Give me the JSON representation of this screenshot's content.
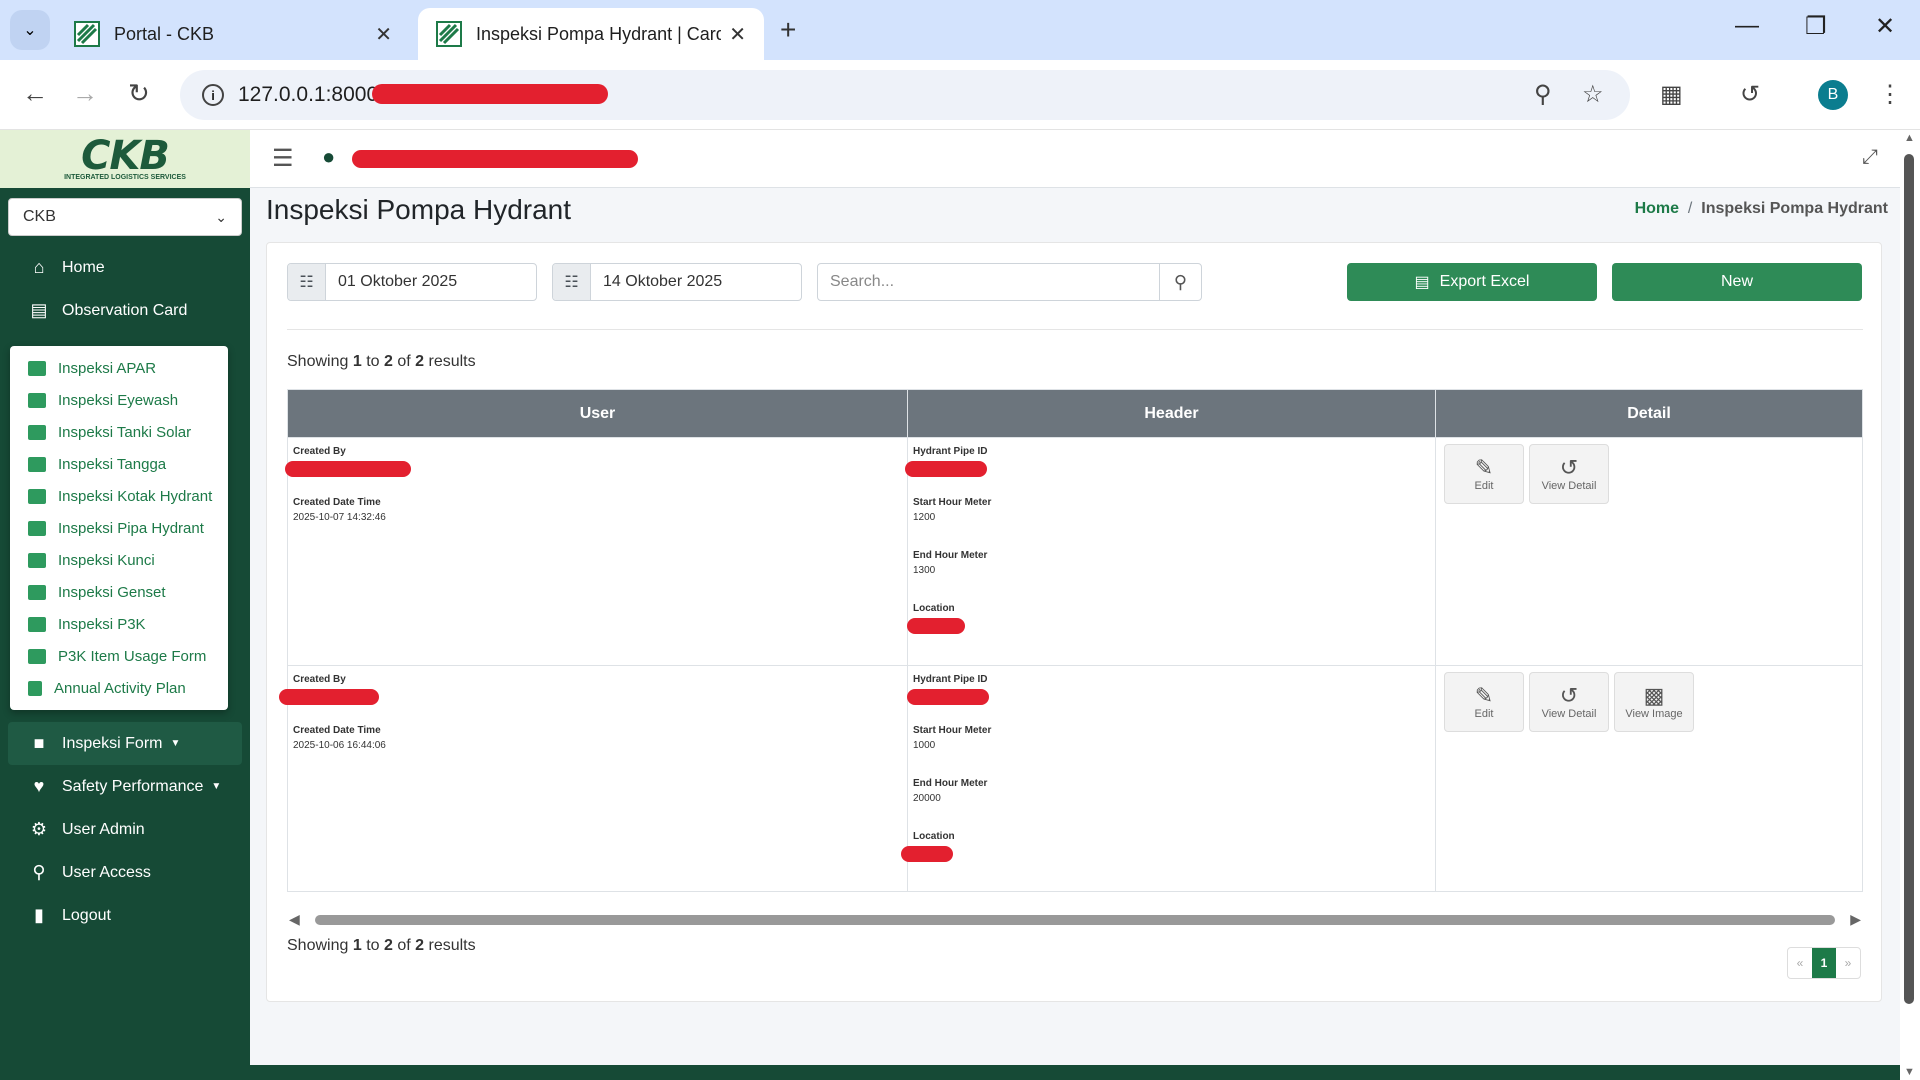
{
  "browser": {
    "tabs": [
      {
        "title": "Portal - CKB"
      },
      {
        "title": "Inspeksi Pompa Hydrant | Card"
      }
    ],
    "url": "127.0.0.1:8000/",
    "profile_initial": "B"
  },
  "sidebar": {
    "logo": "CKB",
    "logo_sub": "INTEGRATED LOGISTICS SERVICES",
    "company": "CKB",
    "items_top": [
      {
        "label": "Home",
        "icon": "home-icon"
      },
      {
        "label": "Observation Card",
        "icon": "clipboard-icon"
      }
    ],
    "dropdown": [
      {
        "label": "Inspeksi APAR"
      },
      {
        "label": "Inspeksi Eyewash"
      },
      {
        "label": "Inspeksi Tanki Solar"
      },
      {
        "label": "Inspeksi Tangga"
      },
      {
        "label": "Inspeksi Kotak Hydrant"
      },
      {
        "label": "Inspeksi Pipa Hydrant"
      },
      {
        "label": "Inspeksi Kunci"
      },
      {
        "label": "Inspeksi Genset"
      },
      {
        "label": "Inspeksi P3K"
      },
      {
        "label": "P3K Item Usage Form"
      },
      {
        "label": "Annual Activity Plan"
      }
    ],
    "items_bottom": [
      {
        "label": "Inspeksi Form",
        "icon": "comment-icon"
      },
      {
        "label": "Safety Performance",
        "icon": "heartbeat-icon"
      },
      {
        "label": "User Admin",
        "icon": "user-cog-icon"
      },
      {
        "label": "User Access",
        "icon": "key-icon"
      },
      {
        "label": "Logout",
        "icon": "door-icon"
      }
    ]
  },
  "page": {
    "title": "Inspeksi Pompa Hydrant",
    "breadcrumb_home": "Home",
    "breadcrumb_current": "Inspeksi Pompa Hydrant"
  },
  "filters": {
    "date_from": "01 Oktober 2025",
    "date_to": "14 Oktober 2025",
    "search_placeholder": "Search...",
    "export_label": "Export Excel",
    "new_label": "New"
  },
  "summary": {
    "prefix": "Showing",
    "from": "1",
    "to_word": "to",
    "to": "2",
    "of_word": "of",
    "total": "2",
    "suffix": "results"
  },
  "table": {
    "headers": [
      "User",
      "Header",
      "Detail"
    ],
    "labels": {
      "created_by": "Created By",
      "created_date": "Created Date Time",
      "pipe_id": "Hydrant Pipe ID",
      "start_hm": "Start Hour Meter",
      "end_hm": "End Hour Meter",
      "location": "Location",
      "edit": "Edit",
      "view_detail": "View Detail",
      "view_image": "View Image"
    },
    "rows": [
      {
        "created_date": "2025-10-07 14:32:46",
        "start_hm": "1200",
        "end_hm": "1300"
      },
      {
        "created_date": "2025-10-06 16:44:06",
        "start_hm": "1000",
        "end_hm": "20000"
      }
    ]
  },
  "pagination": {
    "prev": "«",
    "current": "1",
    "next": "»"
  }
}
